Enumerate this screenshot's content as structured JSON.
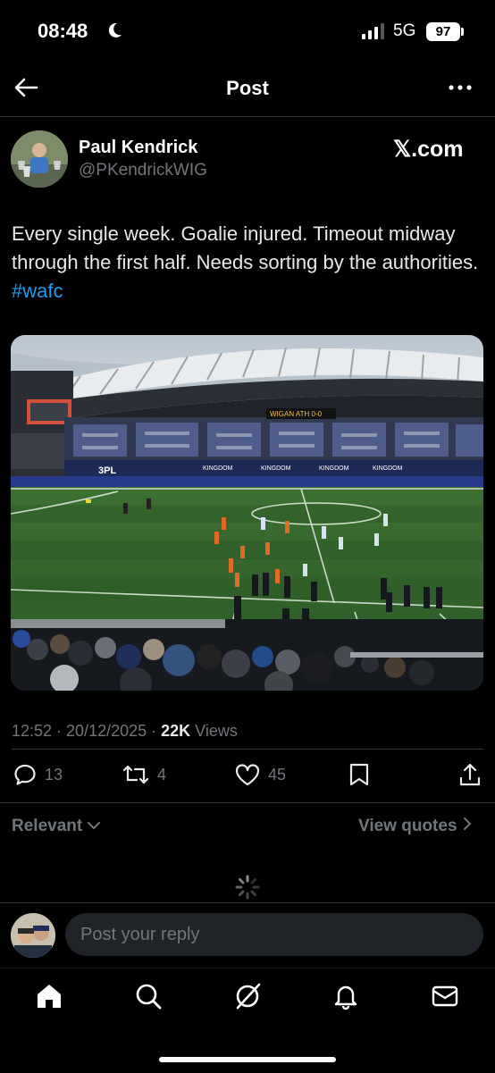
{
  "status": {
    "time": "08:48",
    "network": "5G",
    "battery": "97"
  },
  "header": {
    "title": "Post"
  },
  "post": {
    "author_name": "Paul Kendrick",
    "author_handle": "@PKendrickWIG",
    "source_logo": "𝕏.com",
    "text": "Every single week. Goalie injured. Timeout midway through the first half. Needs sorting by the authorities. ",
    "hashtag": "#wafc",
    "media": {
      "scoreboard_text": "WIGAN ATH 0-0",
      "stand_signs": [
        "KINGDOM",
        "KINGDOM",
        "KINGDOM",
        "KINGDOM"
      ],
      "sponsor_3pl": "3PL"
    },
    "time": "12:52 · 20/12/2025 · ",
    "views_count": "22K",
    "views_label": " Views",
    "replies": "13",
    "reposts": "4",
    "likes": "45"
  },
  "icons": {
    "back": "back-arrow-icon",
    "more": "more-icon",
    "reply": "reply-icon",
    "repost": "repost-icon",
    "like": "like-icon",
    "bookmark": "bookmark-icon",
    "share": "share-icon",
    "home": "home-icon",
    "search": "search-icon",
    "grok": "grok-icon",
    "notifications": "notifications-icon",
    "messages": "messages-icon"
  },
  "sort": {
    "label": "Relevant",
    "view_quotes": "View quotes"
  },
  "reply": {
    "placeholder": "Post your reply"
  },
  "colors": {
    "accent": "#1d9bf0",
    "background": "#000000",
    "muted": "#71767b"
  }
}
